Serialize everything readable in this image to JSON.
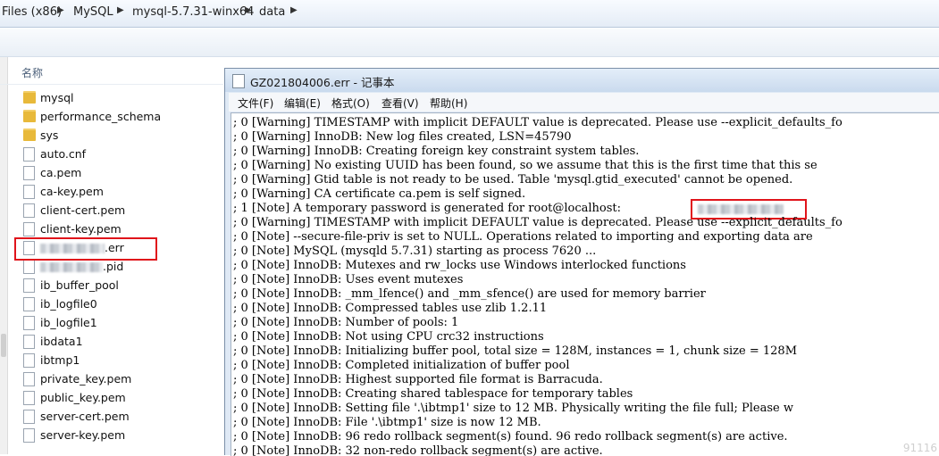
{
  "explorer": {
    "breadcrumb": [
      "Files (x86)",
      "MySQL",
      "mysql-5.7.31-winx64",
      "data"
    ],
    "column_header": "名称",
    "files": [
      {
        "name": "mysql",
        "type": "folder"
      },
      {
        "name": "performance_schema",
        "type": "folder"
      },
      {
        "name": "sys",
        "type": "folder"
      },
      {
        "name": "auto.cnf",
        "type": "file"
      },
      {
        "name": "ca.pem",
        "type": "file"
      },
      {
        "name": "ca-key.pem",
        "type": "file"
      },
      {
        "name": "client-cert.pem",
        "type": "file"
      },
      {
        "name": "client-key.pem",
        "type": "file"
      },
      {
        "name": ".err",
        "type": "file",
        "redacted": true,
        "highlighted": true
      },
      {
        "name": ".pid",
        "type": "file",
        "redacted": true
      },
      {
        "name": "ib_buffer_pool",
        "type": "file"
      },
      {
        "name": "ib_logfile0",
        "type": "file"
      },
      {
        "name": "ib_logfile1",
        "type": "file"
      },
      {
        "name": "ibdata1",
        "type": "file"
      },
      {
        "name": "ibtmp1",
        "type": "file"
      },
      {
        "name": "private_key.pem",
        "type": "file"
      },
      {
        "name": "public_key.pem",
        "type": "file"
      },
      {
        "name": "server-cert.pem",
        "type": "file"
      },
      {
        "name": "server-key.pem",
        "type": "file"
      }
    ]
  },
  "notepad": {
    "title": "GZ021804006.err - 记事本",
    "menu": [
      "文件(F)",
      "编辑(E)",
      "格式(O)",
      "查看(V)",
      "帮助(H)"
    ],
    "lines": [
      "; 0 [Warning] TIMESTAMP with implicit DEFAULT value is deprecated. Please use --explicit_defaults_fo",
      "; 0 [Warning] InnoDB: New log files created, LSN=45790",
      "; 0 [Warning] InnoDB: Creating foreign key constraint system tables.",
      "; 0 [Warning] No existing UUID has been found, so we assume that this is the first time that this se",
      "; 0 [Warning] Gtid table is not ready to be used. Table 'mysql.gtid_executed' cannot be opened.",
      "; 0 [Warning] CA certificate ca.pem is self signed.",
      "; 1 [Note] A temporary password is generated for root@localhost: ",
      "; 0 [Warning] TIMESTAMP with implicit DEFAULT value is deprecated. Please use --explicit_defaults_fo",
      "; 0 [Note] --secure-file-priv is set to NULL. Operations related to importing and exporting data are",
      "; 0 [Note] MySQL (mysqld 5.7.31) starting as process 7620 ...",
      "; 0 [Note] InnoDB: Mutexes and rw_locks use Windows interlocked functions",
      "; 0 [Note] InnoDB: Uses event mutexes",
      "; 0 [Note] InnoDB: _mm_lfence() and _mm_sfence() are used for memory barrier",
      "; 0 [Note] InnoDB: Compressed tables use zlib 1.2.11",
      "; 0 [Note] InnoDB: Number of pools: 1",
      "; 0 [Note] InnoDB: Not using CPU crc32 instructions",
      "; 0 [Note] InnoDB: Initializing buffer pool, total size = 128M, instances = 1, chunk size = 128M",
      "; 0 [Note] InnoDB: Completed initialization of buffer pool",
      "; 0 [Note] InnoDB: Highest supported file format is Barracuda.",
      "; 0 [Note] InnoDB: Creating shared tablespace for temporary tables",
      "; 0 [Note] InnoDB: Setting file '.\\ibtmp1' size to 12 MB. Physically writing the file full; Please w",
      "; 0 [Note] InnoDB: File '.\\ibtmp1' size is now 12 MB.",
      "; 0 [Note] InnoDB: 96 redo rollback segment(s) found. 96 redo rollback segment(s) are active.",
      "; 0 [Note] InnoDB: 32 non-redo rollback segment(s) are active."
    ],
    "watermark": "91116"
  },
  "colors": {
    "highlight_box": "#e0141b",
    "folder": "#e8b93a"
  }
}
